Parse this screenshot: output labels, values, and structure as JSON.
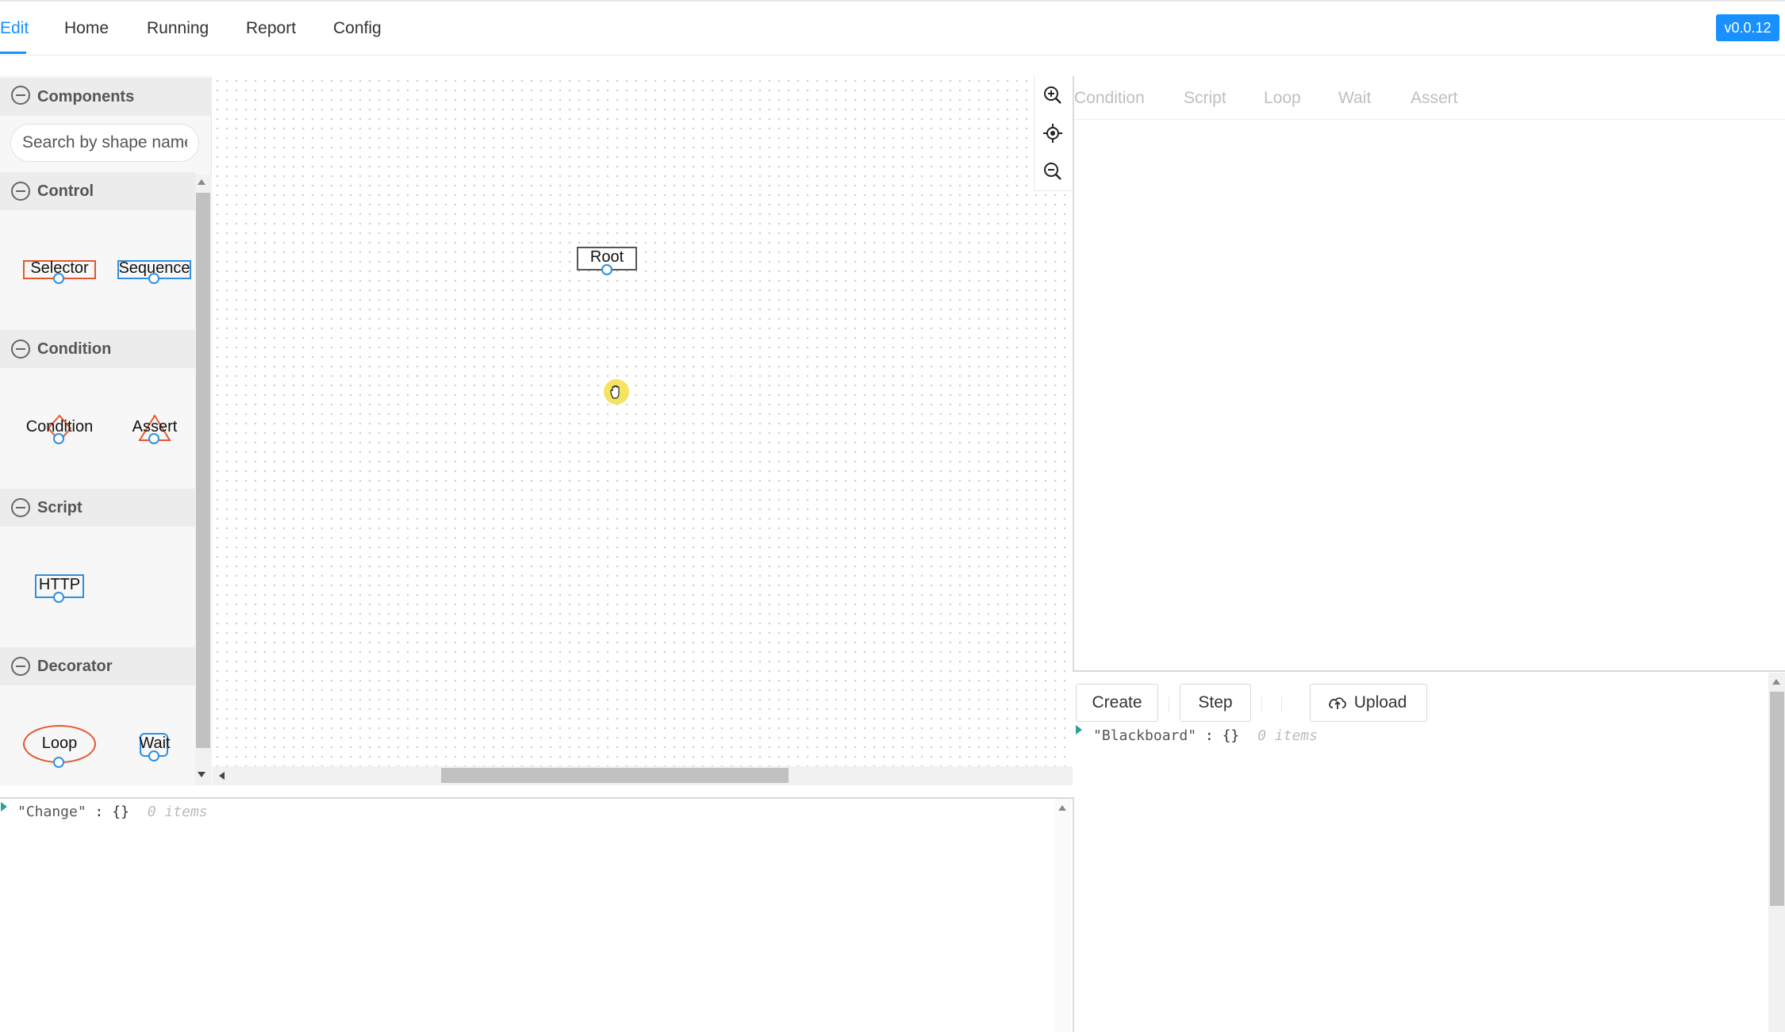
{
  "nav": {
    "tabs": [
      {
        "label": "Edit",
        "active": true
      },
      {
        "label": "Home"
      },
      {
        "label": "Running"
      },
      {
        "label": "Report"
      },
      {
        "label": "Config"
      }
    ],
    "version": "v0.0.12"
  },
  "components": {
    "title": "Components",
    "search_placeholder": "Search by shape name",
    "groups": [
      {
        "title": "Control",
        "items": [
          "Selector",
          "Sequence"
        ]
      },
      {
        "title": "Condition",
        "items": [
          "Condition",
          "Assert"
        ]
      },
      {
        "title": "Script",
        "items": [
          "HTTP"
        ]
      },
      {
        "title": "Decorator",
        "items": [
          "Loop",
          "Wait"
        ]
      }
    ]
  },
  "canvas": {
    "root_label": "Root",
    "tools": [
      "zoom-in-icon",
      "locate-icon",
      "zoom-out-icon"
    ]
  },
  "right_tabs": [
    "Condition",
    "Script",
    "Loop",
    "Wait",
    "Assert"
  ],
  "actions": {
    "create": "Create",
    "step": "Step",
    "upload": "Upload"
  },
  "blackboard": {
    "key": "\"Blackboard\"",
    "value": "{}",
    "count": "0 items"
  },
  "change": {
    "key": "\"Change\"",
    "value": "{}",
    "count": "0 items"
  },
  "colors": {
    "accent": "#1890ff",
    "selector_border": "#e4572e",
    "sequence_border": "#2f8fe0"
  }
}
